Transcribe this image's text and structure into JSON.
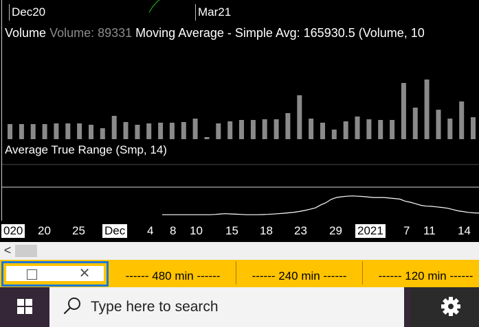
{
  "chart": {
    "top_dates": [
      "Dec20",
      "Mar21"
    ],
    "volume_header": {
      "name": "Volume",
      "value": "Volume: 89331",
      "ma": "Moving Average - Simple",
      "avg": "Avg: 165930.5",
      "params": "(Volume, 10"
    },
    "atr_header": {
      "name": "Average True Range",
      "params": "(Smp, 14)"
    },
    "x_axis_labels": [
      "020",
      "20",
      "25",
      "Dec",
      "4",
      "8",
      "10",
      "15",
      "18",
      "23",
      "29",
      "2021",
      "7",
      "11",
      "14"
    ],
    "colors": {
      "background": "#000000",
      "volume_bar": "#8a8a8a",
      "atr_line": "#ffffff",
      "price_line": "#27c427"
    }
  },
  "chart_data": [
    {
      "type": "bar",
      "values": [
        22,
        22,
        22,
        22,
        23,
        23,
        23,
        21,
        16,
        34,
        25,
        21,
        23,
        24,
        24,
        25,
        30,
        3,
        23,
        26,
        28,
        28,
        29,
        29,
        38,
        64,
        30,
        24,
        14,
        26,
        33,
        29,
        28,
        28,
        82,
        46,
        87,
        43,
        30,
        55,
        32,
        36,
        37,
        41,
        47
      ]
    },
    {
      "type": "line",
      "values": [
        0.1,
        0.1,
        0.1,
        0.1,
        0.1,
        0.1,
        0.1,
        0.1,
        0.1,
        0.1,
        0.11,
        0.13,
        0.14,
        0.13,
        0.12,
        0.11,
        0.1,
        0.1,
        0.1,
        0.105,
        0.114,
        0.126,
        0.14,
        0.156,
        0.174,
        0.195,
        0.225,
        0.262,
        0.31,
        0.36,
        0.47,
        0.56,
        0.69,
        0.76,
        0.79,
        0.81,
        0.82,
        0.81,
        0.8,
        0.78,
        0.76,
        0.76,
        0.76,
        0.74,
        0.72,
        0.7,
        0.62,
        0.58,
        0.52,
        0.46,
        0.43,
        0.42,
        0.4,
        0.38,
        0.35,
        0.3,
        0.25,
        0.22,
        0.19,
        0.17,
        0.16
      ]
    }
  ],
  "scroll": {
    "left_arrow": "<"
  },
  "tabs": {
    "items": [
      "------ 480 min ------",
      "------ 240 min ------",
      "------ 120 min ------"
    ]
  },
  "taskbar": {
    "search_placeholder": "Type here to search"
  }
}
